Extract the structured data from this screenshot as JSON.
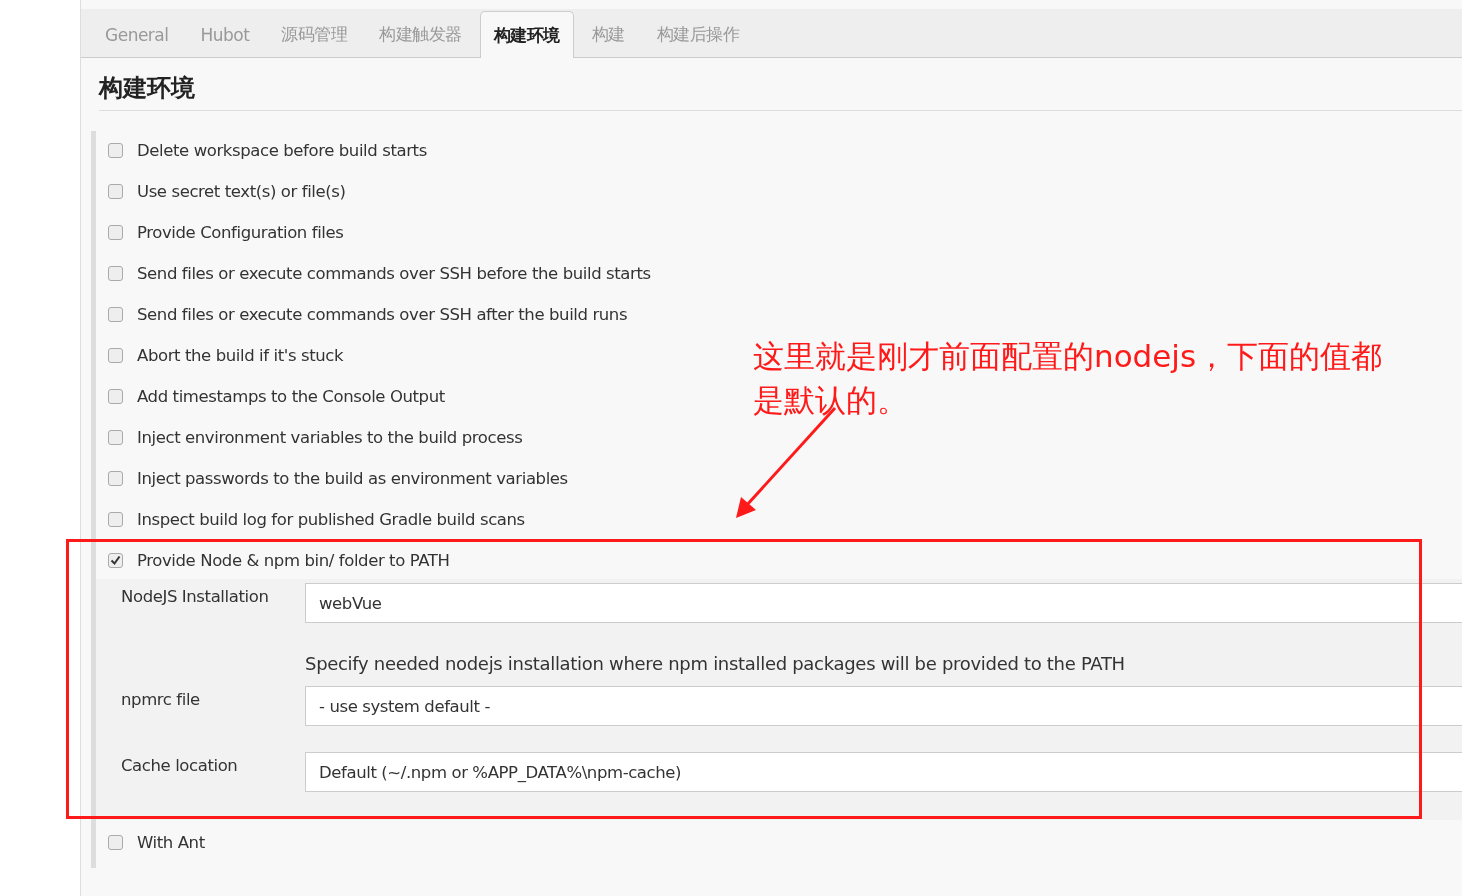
{
  "tabs": [
    {
      "label": "General",
      "selected": false
    },
    {
      "label": "Hubot",
      "selected": false
    },
    {
      "label": "源码管理",
      "selected": false
    },
    {
      "label": "构建触发器",
      "selected": false
    },
    {
      "label": "构建环境",
      "selected": true
    },
    {
      "label": "构建",
      "selected": false
    },
    {
      "label": "构建后操作",
      "selected": false
    }
  ],
  "section": {
    "title": "构建环境"
  },
  "options": [
    {
      "label": "Delete workspace before build starts",
      "checked": false
    },
    {
      "label": "Use secret text(s) or file(s)",
      "checked": false
    },
    {
      "label": "Provide Configuration files",
      "checked": false
    },
    {
      "label": "Send files or execute commands over SSH before the build starts",
      "checked": false
    },
    {
      "label": "Send files or execute commands over SSH after the build runs",
      "checked": false
    },
    {
      "label": "Abort the build if it's stuck",
      "checked": false
    },
    {
      "label": "Add timestamps to the Console Output",
      "checked": false
    },
    {
      "label": "Inject environment variables to the build process",
      "checked": false
    },
    {
      "label": "Inject passwords to the build as environment variables",
      "checked": false
    },
    {
      "label": "Inspect build log for published Gradle build scans",
      "checked": false
    },
    {
      "label": "Provide Node & npm bin/ folder to PATH",
      "checked": true,
      "fields": [
        {
          "label": "NodeJS Installation",
          "value": "webVue",
          "help": "Specify needed nodejs installation where npm installed packages will be provided to the PATH"
        },
        {
          "label": "npmrc file",
          "value": "- use system default -"
        },
        {
          "label": "Cache location",
          "value": "Default (~/.npm or %APP_DATA%\\npm-cache)"
        }
      ]
    },
    {
      "label": "With Ant",
      "checked": false
    }
  ],
  "annotation": {
    "text": "这里就是刚才前面配置的nodejs，下面的值都是默认的。"
  }
}
